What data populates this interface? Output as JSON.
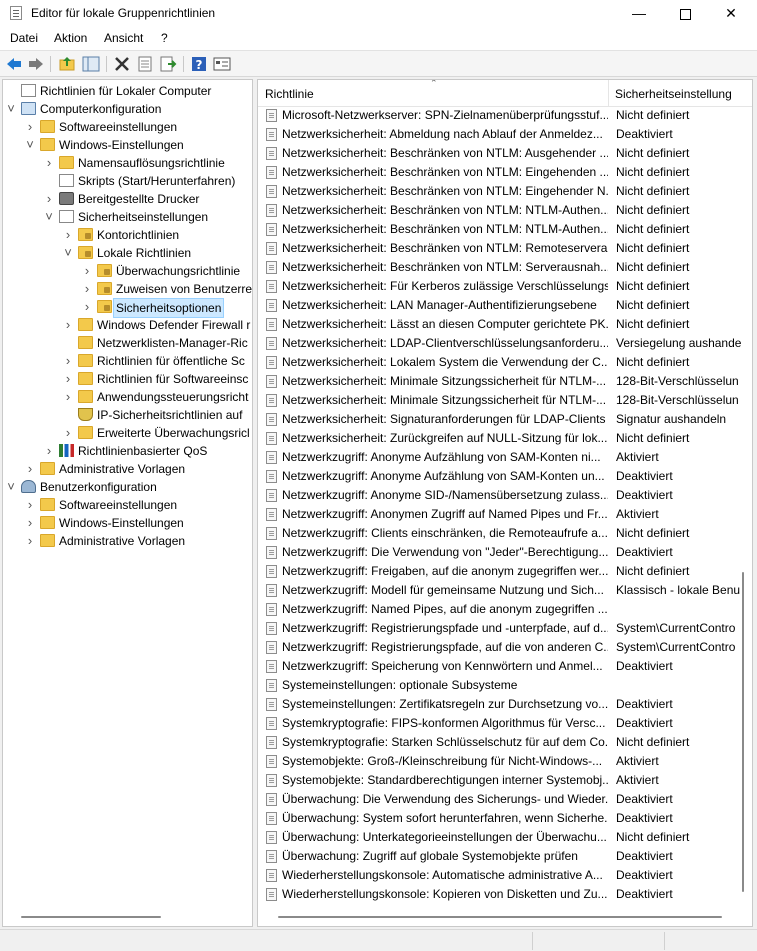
{
  "window": {
    "title": "Editor für lokale Gruppenrichtlinien"
  },
  "menu": [
    "Datei",
    "Aktion",
    "Ansicht",
    "?"
  ],
  "toolbar": [
    "back-icon",
    "forward-icon",
    "up-folder-icon",
    "show-hide-tree-icon",
    "delete-icon",
    "properties-icon",
    "export-list-icon",
    "help-icon",
    "view-icon"
  ],
  "tree": [
    {
      "label": "Richtlinien für Lokaler Computer",
      "icon": "policy-doc",
      "depth": 0,
      "twisty": ""
    },
    {
      "label": "Computerkonfiguration",
      "icon": "computer",
      "depth": 0,
      "twisty": "open"
    },
    {
      "label": "Softwareeinstellungen",
      "icon": "folder",
      "depth": 1,
      "twisty": "closed"
    },
    {
      "label": "Windows-Einstellungen",
      "icon": "folder",
      "depth": 1,
      "twisty": "open"
    },
    {
      "label": "Namensauflösungsrichtlinie",
      "icon": "folder",
      "depth": 2,
      "twisty": "closed"
    },
    {
      "label": "Skripts (Start/Herunterfahren)",
      "icon": "doc",
      "depth": 2,
      "twisty": ""
    },
    {
      "label": "Bereitgestellte Drucker",
      "icon": "printer",
      "depth": 2,
      "twisty": "closed"
    },
    {
      "label": "Sicherheitseinstellungen",
      "icon": "doc",
      "depth": 2,
      "twisty": "open"
    },
    {
      "label": "Kontorichtlinien",
      "icon": "folder-lock",
      "depth": 3,
      "twisty": "closed"
    },
    {
      "label": "Lokale Richtlinien",
      "icon": "folder-lock",
      "depth": 3,
      "twisty": "open"
    },
    {
      "label": "Überwachungsrichtlinie",
      "icon": "folder-lock",
      "depth": 4,
      "twisty": "closed"
    },
    {
      "label": "Zuweisen von Benutzerre",
      "icon": "folder-lock",
      "depth": 4,
      "twisty": "closed"
    },
    {
      "label": "Sicherheitsoptionen",
      "icon": "folder-lock",
      "depth": 4,
      "twisty": "closed",
      "selected": true
    },
    {
      "label": "Windows Defender Firewall r",
      "icon": "folder",
      "depth": 3,
      "twisty": "closed"
    },
    {
      "label": "Netzwerklisten-Manager-Ric",
      "icon": "folder",
      "depth": 3,
      "twisty": ""
    },
    {
      "label": "Richtlinien für öffentliche Sc",
      "icon": "folder",
      "depth": 3,
      "twisty": "closed"
    },
    {
      "label": "Richtlinien für Softwareeinsc",
      "icon": "folder",
      "depth": 3,
      "twisty": "closed"
    },
    {
      "label": "Anwendungssteuerungsricht",
      "icon": "folder",
      "depth": 3,
      "twisty": "closed"
    },
    {
      "label": "IP-Sicherheitsrichtlinien auf",
      "icon": "shield",
      "depth": 3,
      "twisty": ""
    },
    {
      "label": "Erweiterte Überwachungsricl",
      "icon": "folder",
      "depth": 3,
      "twisty": "closed"
    },
    {
      "label": "Richtlinienbasierter QoS",
      "icon": "chart",
      "depth": 2,
      "twisty": "closed"
    },
    {
      "label": "Administrative Vorlagen",
      "icon": "folder",
      "depth": 1,
      "twisty": "closed"
    },
    {
      "label": "Benutzerkonfiguration",
      "icon": "user",
      "depth": 0,
      "twisty": "open"
    },
    {
      "label": "Softwareeinstellungen",
      "icon": "folder",
      "depth": 1,
      "twisty": "closed"
    },
    {
      "label": "Windows-Einstellungen",
      "icon": "folder",
      "depth": 1,
      "twisty": "closed"
    },
    {
      "label": "Administrative Vorlagen",
      "icon": "folder",
      "depth": 1,
      "twisty": "closed"
    }
  ],
  "list": {
    "columns": [
      "Richtlinie",
      "Sicherheitseinstellung"
    ],
    "rows": [
      [
        "Microsoft-Netzwerkserver: SPN-Zielnamenüberprüfungsstuf...",
        "Nicht definiert"
      ],
      [
        "Netzwerksicherheit: Abmeldung nach Ablauf der Anmeldez...",
        "Deaktiviert"
      ],
      [
        "Netzwerksicherheit: Beschränken von NTLM: Ausgehender ...",
        "Nicht definiert"
      ],
      [
        "Netzwerksicherheit: Beschränken von NTLM: Eingehenden ...",
        "Nicht definiert"
      ],
      [
        "Netzwerksicherheit: Beschränken von NTLM: Eingehender N...",
        "Nicht definiert"
      ],
      [
        "Netzwerksicherheit: Beschränken von NTLM: NTLM-Authen...",
        "Nicht definiert"
      ],
      [
        "Netzwerksicherheit: Beschränken von NTLM: NTLM-Authen...",
        "Nicht definiert"
      ],
      [
        "Netzwerksicherheit: Beschränken von NTLM: Remoteservera...",
        "Nicht definiert"
      ],
      [
        "Netzwerksicherheit: Beschränken von NTLM: Serverausnah...",
        "Nicht definiert"
      ],
      [
        "Netzwerksicherheit: Für Kerberos zulässige Verschlüsselungs...",
        "Nicht definiert"
      ],
      [
        "Netzwerksicherheit: LAN Manager-Authentifizierungsebene",
        "Nicht definiert"
      ],
      [
        "Netzwerksicherheit: Lässt an diesen Computer gerichtete PK...",
        "Nicht definiert"
      ],
      [
        "Netzwerksicherheit: LDAP-Clientverschlüsselungsanforderu...",
        "Versiegelung aushande"
      ],
      [
        "Netzwerksicherheit: Lokalem System die Verwendung der C...",
        "Nicht definiert"
      ],
      [
        "Netzwerksicherheit: Minimale Sitzungssicherheit für NTLM-...",
        "128-Bit-Verschlüsselun"
      ],
      [
        "Netzwerksicherheit: Minimale Sitzungssicherheit für NTLM-...",
        "128-Bit-Verschlüsselun"
      ],
      [
        "Netzwerksicherheit: Signaturanforderungen für LDAP-Clients",
        "Signatur aushandeln"
      ],
      [
        "Netzwerksicherheit: Zurückgreifen auf NULL-Sitzung für lok...",
        "Nicht definiert"
      ],
      [
        "Netzwerkzugriff: Anonyme Aufzählung von SAM-Konten ni...",
        "Aktiviert"
      ],
      [
        "Netzwerkzugriff: Anonyme Aufzählung von SAM-Konten un...",
        "Deaktiviert"
      ],
      [
        "Netzwerkzugriff: Anonyme SID-/Namensübersetzung zulass...",
        "Deaktiviert"
      ],
      [
        "Netzwerkzugriff: Anonymen Zugriff auf Named Pipes und Fr...",
        "Aktiviert"
      ],
      [
        "Netzwerkzugriff: Clients einschränken, die Remoteaufrufe a...",
        "Nicht definiert"
      ],
      [
        "Netzwerkzugriff: Die Verwendung von \"Jeder\"-Berechtigung...",
        "Deaktiviert"
      ],
      [
        "Netzwerkzugriff: Freigaben, auf die anonym zugegriffen wer...",
        "Nicht definiert"
      ],
      [
        "Netzwerkzugriff: Modell für gemeinsame Nutzung und Sich...",
        "Klassisch - lokale Benu"
      ],
      [
        "Netzwerkzugriff: Named Pipes, auf die anonym zugegriffen ...",
        ""
      ],
      [
        "Netzwerkzugriff: Registrierungspfade und -unterpfade, auf d...",
        "System\\CurrentContro"
      ],
      [
        "Netzwerkzugriff: Registrierungspfade, auf die von anderen C...",
        "System\\CurrentContro"
      ],
      [
        "Netzwerkzugriff: Speicherung von Kennwörtern und Anmel...",
        "Deaktiviert"
      ],
      [
        "Systemeinstellungen: optionale Subsysteme",
        ""
      ],
      [
        "Systemeinstellungen: Zertifikatsregeln zur Durchsetzung vo...",
        "Deaktiviert"
      ],
      [
        "Systemkryptografie: FIPS-konformen Algorithmus für Versc...",
        "Deaktiviert"
      ],
      [
        "Systemkryptografie: Starken Schlüsselschutz für auf dem Co...",
        "Nicht definiert"
      ],
      [
        "Systemobjekte: Groß-/Kleinschreibung für Nicht-Windows-...",
        "Aktiviert"
      ],
      [
        "Systemobjekte: Standardberechtigungen interner Systemobj...",
        "Aktiviert"
      ],
      [
        "Überwachung: Die Verwendung des Sicherungs- und Wieder...",
        "Deaktiviert"
      ],
      [
        "Überwachung: System sofort herunterfahren, wenn Sicherhe...",
        "Deaktiviert"
      ],
      [
        "Überwachung: Unterkategorieeinstellungen der Überwachu...",
        "Nicht definiert"
      ],
      [
        "Überwachung: Zugriff auf globale Systemobjekte prüfen",
        "Deaktiviert"
      ],
      [
        "Wiederherstellungskonsole: Automatische administrative A...",
        "Deaktiviert"
      ],
      [
        "Wiederherstellungskonsole: Kopieren von Disketten und Zu...",
        "Deaktiviert"
      ]
    ]
  }
}
